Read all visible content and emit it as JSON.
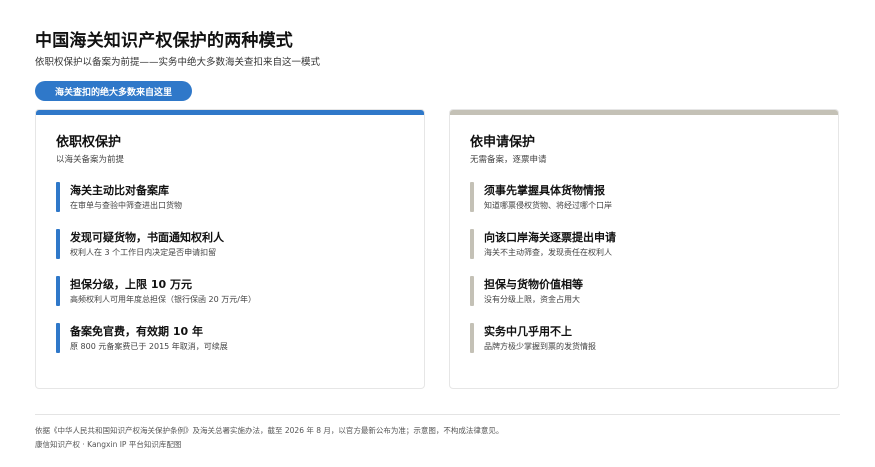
{
  "header": {
    "title": "中国海关知识产权保护的两种模式",
    "subtitle": "依职权保护以备案为前提——实务中绝大多数海关查扣来自这一模式",
    "pill": "海关查扣的绝大多数来自这里"
  },
  "left_card": {
    "title": "依职权保护",
    "subtitle": "以海关备案为前提",
    "items": [
      {
        "head": "海关主动比对备案库",
        "desc": "在审单与查验中筛查进出口货物"
      },
      {
        "head": "发现可疑货物，书面通知权利人",
        "desc": "权利人在 3 个工作日内决定是否申请扣留"
      },
      {
        "head": "担保分级，上限 10 万元",
        "desc": "高频权利人可用年度总担保（银行保函 20 万元/年）"
      },
      {
        "head": "备案免官费，有效期 10 年",
        "desc": "原 800 元备案费已于 2015 年取消，可续展"
      }
    ]
  },
  "right_card": {
    "title": "依申请保护",
    "subtitle": "无需备案，逐票申请",
    "items": [
      {
        "head": "须事先掌握具体货物情报",
        "desc": "知道哪票侵权货物、将经过哪个口岸"
      },
      {
        "head": "向该口岸海关逐票提出申请",
        "desc": "海关不主动筛查，发现责任在权利人"
      },
      {
        "head": "担保与货物价值相等",
        "desc": "没有分级上限，资金占用大"
      },
      {
        "head": "实务中几乎用不上",
        "desc": "品牌方极少掌握到票的发货情报"
      }
    ]
  },
  "footer": {
    "note": "依据《中华人民共和国知识产权海关保护条例》及海关总署实施办法，截至 2026 年 8 月，以官方最新公布为准；示意图，不构成法律意见。",
    "credit": "康信知识产权 · Kangxin IP 平台知识库配图"
  },
  "colors": {
    "accent_blue": "#2f78c9",
    "accent_gray": "#c4c1b6"
  }
}
